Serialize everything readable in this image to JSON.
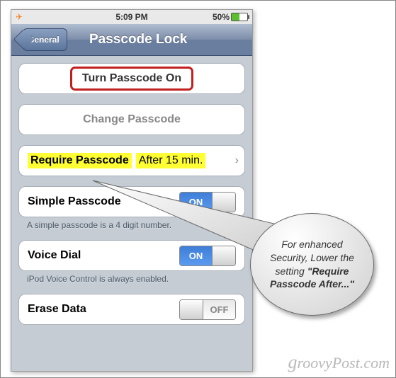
{
  "status": {
    "time": "5:09 PM",
    "battery_pct": "50%",
    "airplane_icon": "✈"
  },
  "nav": {
    "back_label": "General",
    "title": "Passcode Lock"
  },
  "cells": {
    "turn_on": "Turn Passcode On",
    "change": "Change Passcode",
    "require_label": "Require Passcode",
    "require_value": "After 15 min.",
    "simple_label": "Simple Passcode",
    "simple_hint": "A simple passcode is a 4 digit number.",
    "voice_label": "Voice Dial",
    "voice_hint": "iPod Voice Control is always enabled.",
    "erase_label": "Erase Data"
  },
  "toggle": {
    "on_text": "ON",
    "off_text": "OFF"
  },
  "callout": {
    "line1": "For enhanced Security, Lower the setting ",
    "strong": "\"Require Passcode After...\""
  },
  "watermark": "groovyPost.com"
}
